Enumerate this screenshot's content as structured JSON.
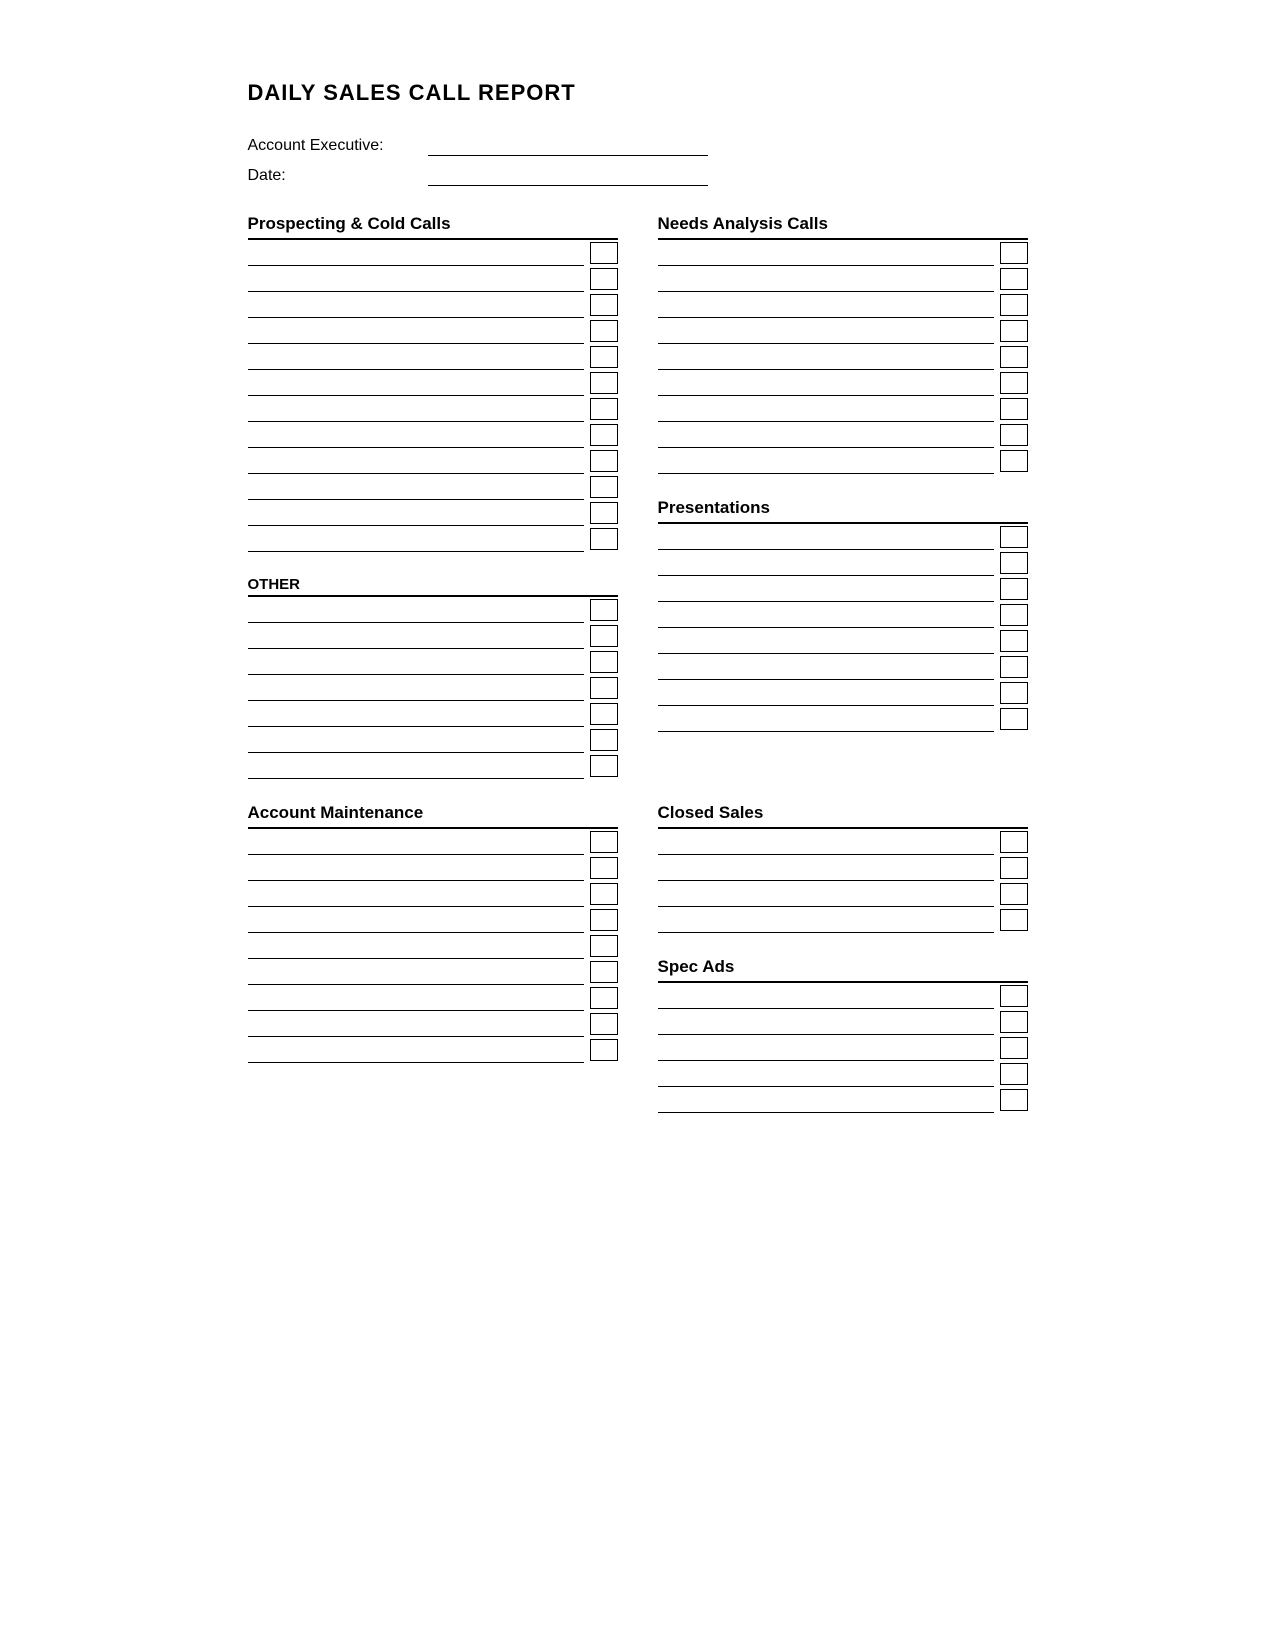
{
  "page": {
    "title": "DAILY SALES CALL REPORT",
    "account_executive_label": "Account Executive:",
    "date_label": "Date:",
    "left_col": {
      "prospecting_title": "Prospecting & Cold Calls",
      "prospecting_rows": 12,
      "other_title": "OTHER",
      "other_rows": 7
    },
    "right_col": {
      "needs_analysis_title": "Needs Analysis Calls",
      "needs_analysis_rows": 9,
      "presentations_title": "Presentations",
      "presentations_rows": 8
    },
    "bottom_left": {
      "title": "Account Maintenance",
      "rows": 9
    },
    "bottom_right_top": {
      "title": "Closed Sales",
      "rows": 4
    },
    "bottom_right_bottom": {
      "title": "Spec Ads",
      "rows": 5
    }
  }
}
